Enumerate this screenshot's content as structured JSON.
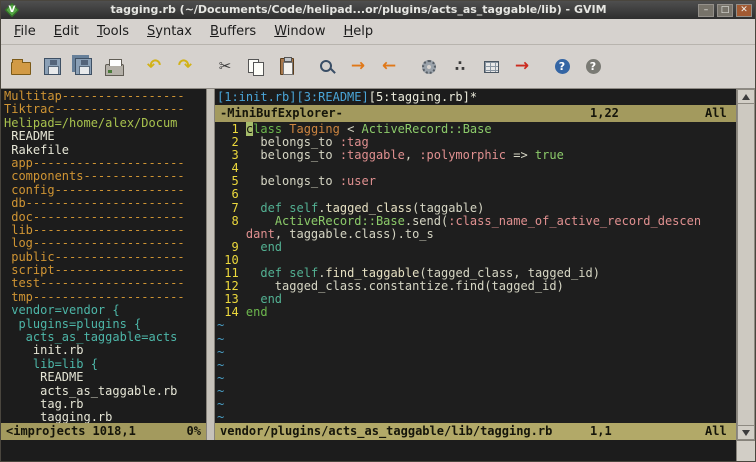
{
  "window": {
    "title": "tagging.rb (~/Documents/Code/helipad...or/plugins/acts_as_taggable/lib) - GVIM",
    "controls": {
      "minimize": "–",
      "maximize": "□",
      "close": "✕"
    }
  },
  "menubar": [
    "File",
    "Edit",
    "Tools",
    "Syntax",
    "Buffers",
    "Window",
    "Help"
  ],
  "toolbar": {
    "groups": [
      [
        "open",
        "save",
        "save-all",
        "print"
      ],
      [
        "undo",
        "redo"
      ],
      [
        "cut",
        "copy",
        "paste"
      ],
      [
        "find-replace",
        "find-next",
        "find-prev"
      ],
      [
        "make",
        "run-ctags",
        "tag-list",
        "tag-jump"
      ],
      [
        "help",
        "find-help"
      ]
    ]
  },
  "explorer": {
    "lines": [
      {
        "text": "Multitap-----------------",
        "type": "fold"
      },
      {
        "text": "Tiktrac------------------",
        "type": "fold"
      },
      {
        "text": "Helipad=/home/alex/Docum",
        "type": "proj"
      },
      {
        "text": " README",
        "type": "file"
      },
      {
        "text": " Rakefile",
        "type": "file"
      },
      {
        "text": " app---------------------",
        "type": "fold"
      },
      {
        "text": " components--------------",
        "type": "fold"
      },
      {
        "text": " config------------------",
        "type": "fold"
      },
      {
        "text": " db----------------------",
        "type": "fold"
      },
      {
        "text": " doc---------------------",
        "type": "fold"
      },
      {
        "text": " lib---------------------",
        "type": "fold"
      },
      {
        "text": " log---------------------",
        "type": "fold"
      },
      {
        "text": " public------------------",
        "type": "fold"
      },
      {
        "text": " script------------------",
        "type": "fold"
      },
      {
        "text": " test--------------------",
        "type": "fold"
      },
      {
        "text": " tmp---------------------",
        "type": "fold"
      },
      {
        "text": " vendor=vendor {",
        "type": "dir"
      },
      {
        "text": "  plugins=plugins {",
        "type": "dir"
      },
      {
        "text": "   acts_as_taggable=acts",
        "type": "dir"
      },
      {
        "text": "    init.rb",
        "type": "file"
      },
      {
        "text": "    lib=lib {",
        "type": "dir"
      },
      {
        "text": "     README",
        "type": "file"
      },
      {
        "text": "     acts_as_taggable.rb",
        "type": "file"
      },
      {
        "text": "     tag.rb",
        "type": "file"
      },
      {
        "text": "     tagging.rb",
        "type": "file"
      }
    ],
    "status": {
      "file": "<improjects",
      "position": "1018,1",
      "percent": "0%"
    }
  },
  "minibufexplorer": {
    "buffers": [
      {
        "label": "[1:init.rb]",
        "active": false
      },
      {
        "label": "[3:README]",
        "active": false
      },
      {
        "label": "[5:tagging.rb]*",
        "active": true
      }
    ],
    "status": {
      "name": "-MiniBufExplorer-",
      "position": "1,22",
      "scroll": "All"
    }
  },
  "editor": {
    "lines": [
      {
        "num": "1",
        "segs": [
          {
            "t": "c",
            "c": "cur"
          },
          {
            "t": "lass",
            "c": "kw"
          },
          {
            "t": " "
          },
          {
            "t": "Tagging",
            "c": "const"
          },
          {
            "t": " < "
          },
          {
            "t": "ActiveRecord::Base",
            "c": "type"
          }
        ]
      },
      {
        "num": "2",
        "segs": [
          {
            "t": "  belongs_to "
          },
          {
            "t": ":tag",
            "c": "sym"
          }
        ]
      },
      {
        "num": "3",
        "segs": [
          {
            "t": "  belongs_to "
          },
          {
            "t": ":taggable",
            "c": "sym"
          },
          {
            "t": ", "
          },
          {
            "t": ":polymorphic",
            "c": "sym"
          },
          {
            "t": " => "
          },
          {
            "t": "true",
            "c": "bool"
          }
        ]
      },
      {
        "num": "4",
        "segs": []
      },
      {
        "num": "5",
        "segs": [
          {
            "t": "  belongs_to "
          },
          {
            "t": ":user",
            "c": "sym"
          }
        ]
      },
      {
        "num": "6",
        "segs": []
      },
      {
        "num": "7",
        "segs": [
          {
            "t": "  "
          },
          {
            "t": "def",
            "c": "kw2"
          },
          {
            "t": " "
          },
          {
            "t": "self",
            "c": "kw2"
          },
          {
            "t": "."
          },
          {
            "t": "tagged_class",
            "c": "fn"
          },
          {
            "t": "(taggable)"
          }
        ]
      },
      {
        "num": "8",
        "segs": [
          {
            "t": "    "
          },
          {
            "t": "ActiveRecord::Base",
            "c": "type"
          },
          {
            "t": ".send("
          },
          {
            "t": ":class_name_of_active_record_descen",
            "c": "sym"
          }
        ]
      },
      {
        "num": null,
        "segs": [
          {
            "t": "dant",
            "c": "sym"
          },
          {
            "t": ", taggable.class).to_s"
          }
        ]
      },
      {
        "num": "9",
        "segs": [
          {
            "t": "  "
          },
          {
            "t": "end",
            "c": "kw2"
          }
        ]
      },
      {
        "num": "10",
        "segs": []
      },
      {
        "num": "11",
        "segs": [
          {
            "t": "  "
          },
          {
            "t": "def",
            "c": "kw2"
          },
          {
            "t": " "
          },
          {
            "t": "self",
            "c": "kw2"
          },
          {
            "t": "."
          },
          {
            "t": "find_taggable",
            "c": "fn"
          },
          {
            "t": "(tagged_class, tagged_id)"
          }
        ]
      },
      {
        "num": "12",
        "segs": [
          {
            "t": "    tagged_class.constantize.find(tagged_id)"
          }
        ]
      },
      {
        "num": "13",
        "segs": [
          {
            "t": "  "
          },
          {
            "t": "end",
            "c": "kw2"
          }
        ]
      },
      {
        "num": "14",
        "segs": [
          {
            "t": "end",
            "c": "kw"
          }
        ]
      }
    ],
    "tildes": 8,
    "status": {
      "file": "vendor/plugins/acts_as_taggable/lib/tagging.rb",
      "position": "1,1",
      "scroll": "All"
    }
  },
  "colors": {
    "editor_background": "#1c1c1c",
    "status_bar": "#a39a5e",
    "line_number": "#ecd93c",
    "symbol": "#e09090",
    "keyword": "#6db84e",
    "buffer_inactive": "#4aa5d8",
    "tree_fold": "#cf9433",
    "tree_dir": "#4db6a8",
    "chrome": "#d6d2ce"
  }
}
